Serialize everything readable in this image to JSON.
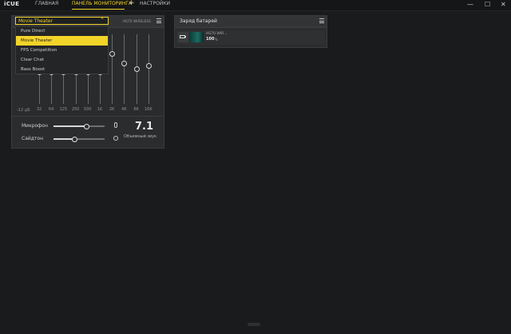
{
  "app": {
    "brand": "iCUE"
  },
  "nav": {
    "home": "ГЛАВНАЯ",
    "dashboard": "ПАНЕЛЬ МОНИТОРИНГА",
    "add": "+",
    "settings": "НАСТРОЙКИ"
  },
  "window": {
    "minimize": "—",
    "maximize": "☐",
    "close": "✕"
  },
  "eq_panel": {
    "device": "HS70 WIRELESS",
    "preset_selected": "Movie Theater",
    "presets": [
      "Pure Direct",
      "Movie Theater",
      "FPS Competition",
      "Clear Chat",
      "Bass Boost"
    ],
    "bands": [
      {
        "label": "32",
        "level": 0.45
      },
      {
        "label": "64",
        "level": 0.45
      },
      {
        "label": "125",
        "level": 0.45
      },
      {
        "label": "250",
        "level": 0.45
      },
      {
        "label": "500",
        "level": 0.45
      },
      {
        "label": "1K",
        "level": 0.45
      },
      {
        "label": "2K",
        "level": 0.72
      },
      {
        "label": "4K",
        "level": 0.58
      },
      {
        "label": "8K",
        "level": 0.5
      },
      {
        "label": "16K",
        "level": 0.55
      }
    ],
    "db_label": "-12 дБ",
    "mic_label": "Микрофон",
    "mic_level": 0.65,
    "sidetone_label": "Сайдтон",
    "sidetone_level": 0.42,
    "surround_value": "7.1",
    "surround_label": "Объемный звук"
  },
  "battery_panel": {
    "title": "Заряд батарей",
    "device_name": "HS70 WIR...",
    "value": "100",
    "unit": "%"
  },
  "colors": {
    "accent": "#f3d429"
  }
}
